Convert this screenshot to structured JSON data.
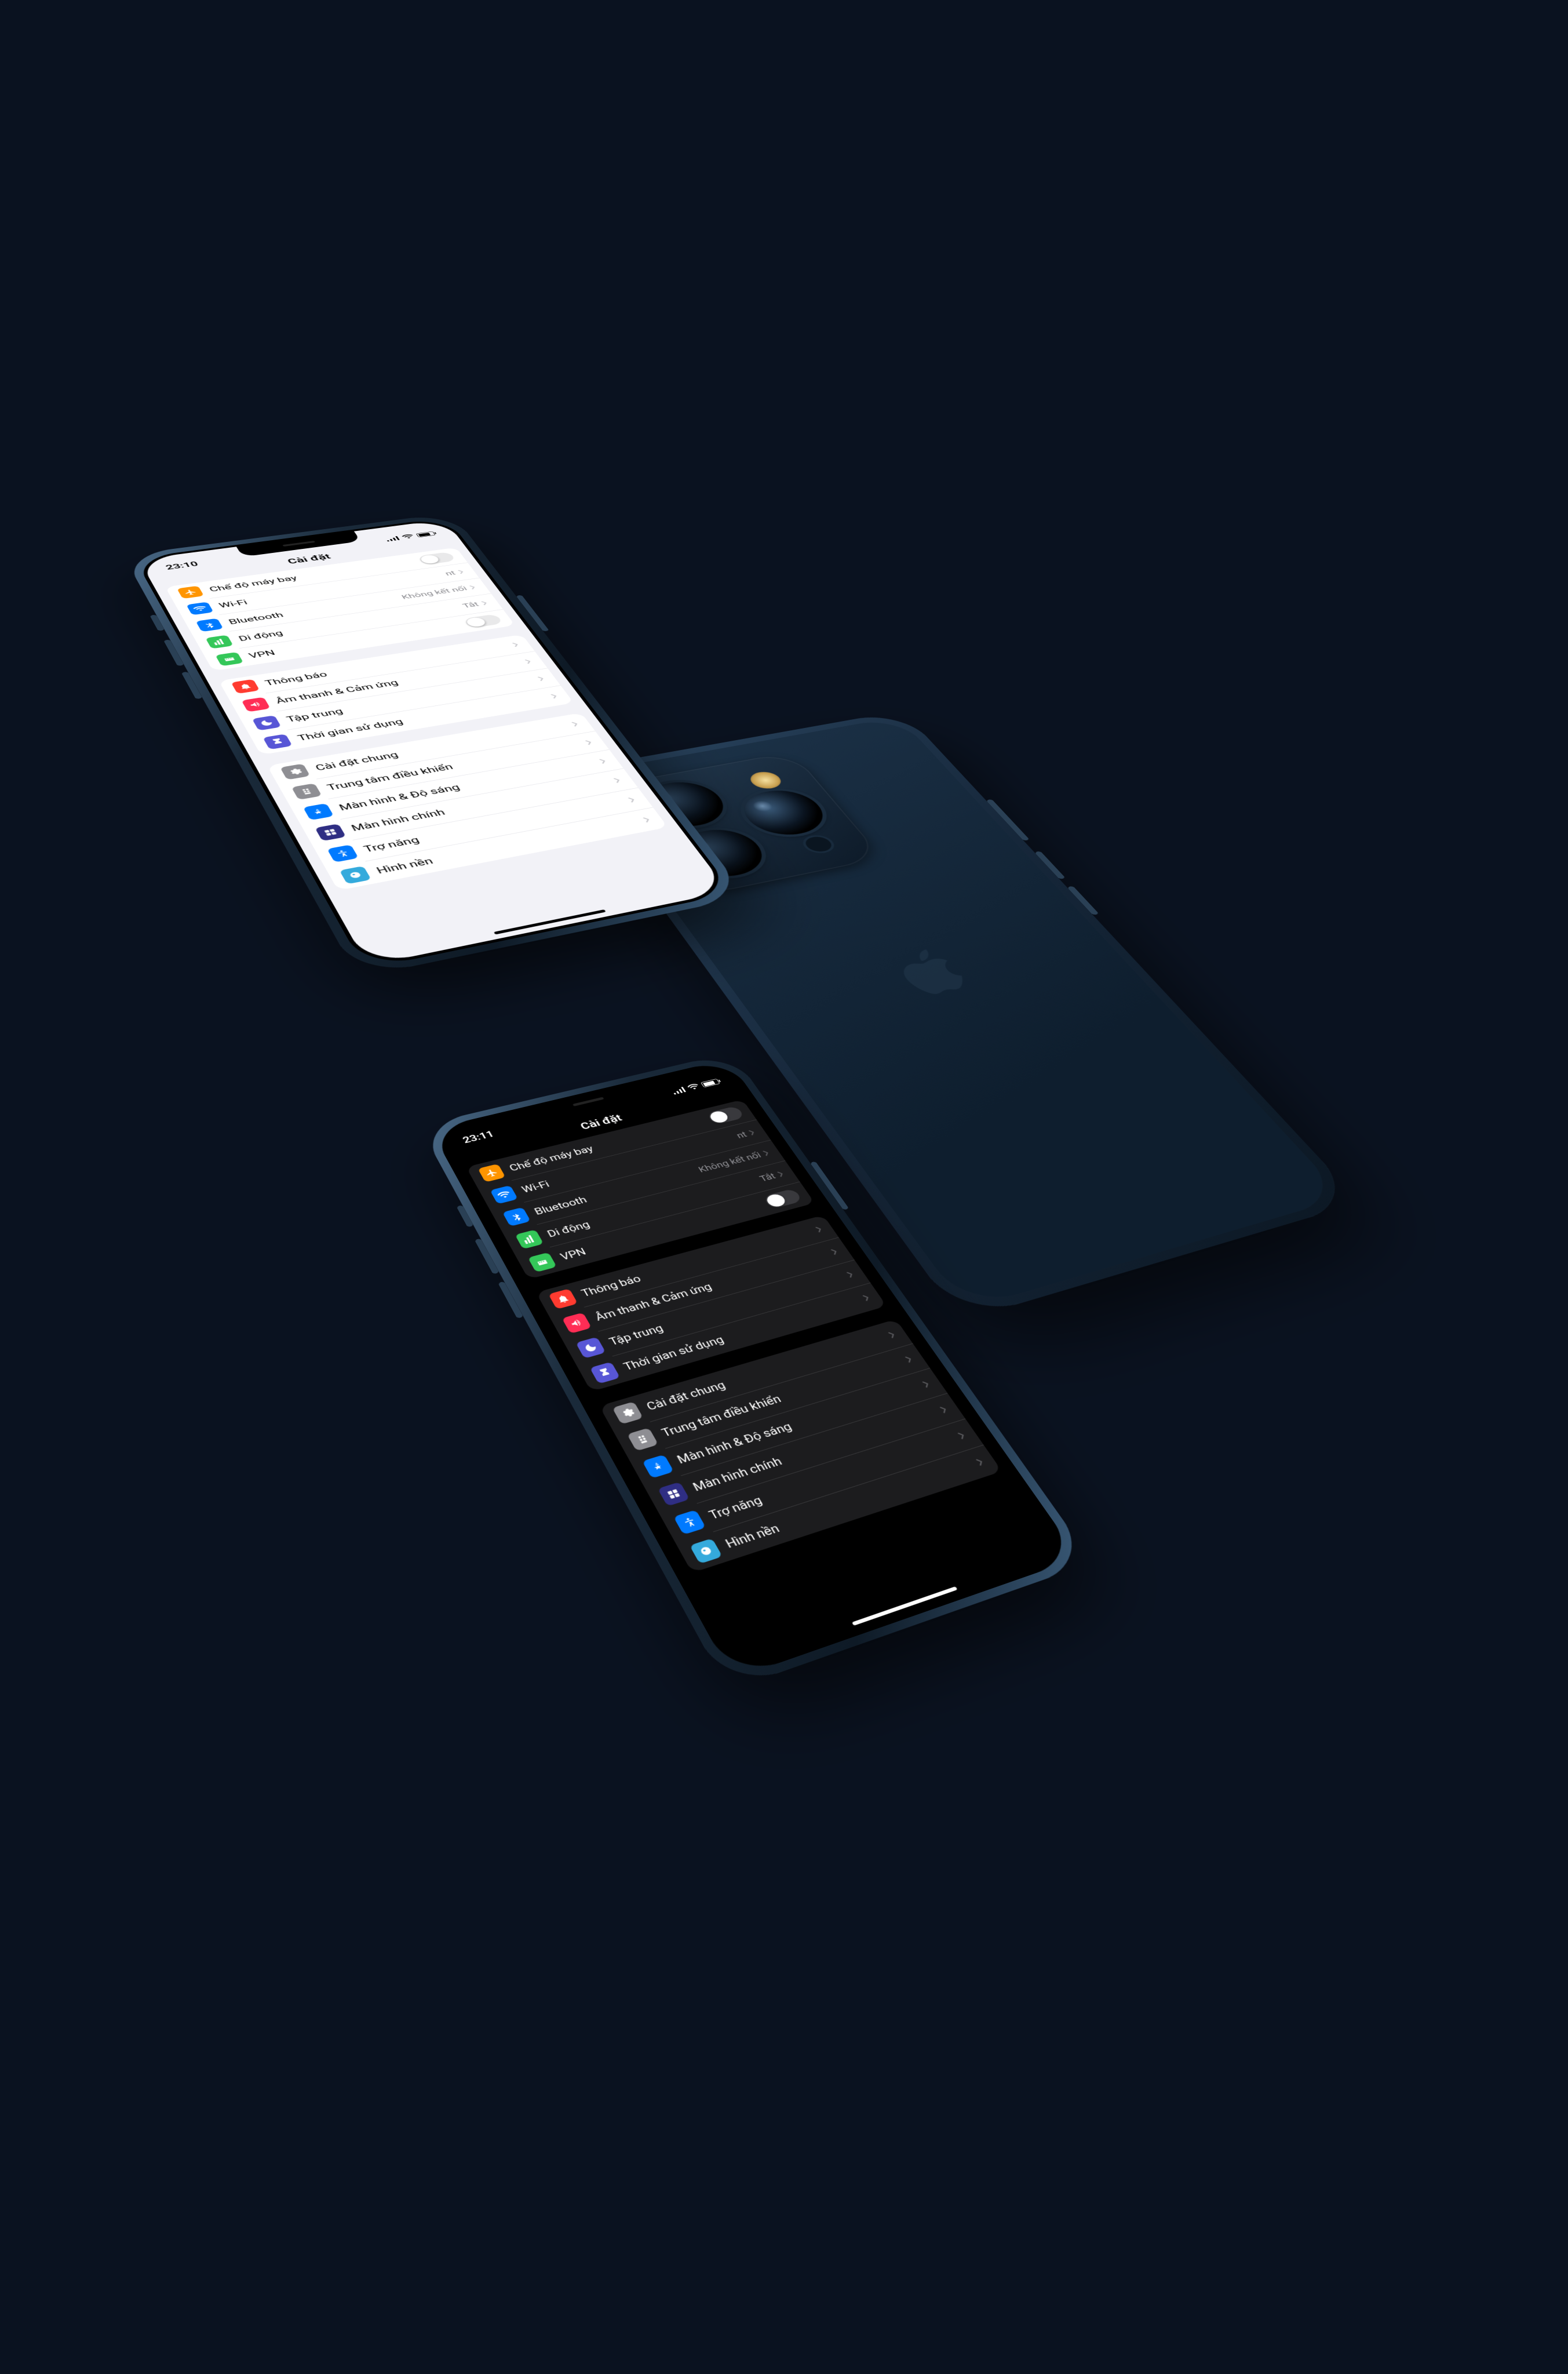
{
  "background_color": "#0a1220",
  "light": {
    "status": {
      "time": "23:10"
    },
    "title": "Cài đặt",
    "groups": [
      [
        {
          "icon": "airplane",
          "label": "Chế độ máy bay",
          "detail": "",
          "switch": true,
          "chevron": false
        },
        {
          "icon": "wifi",
          "label": "Wi-Fi",
          "detail": "nt",
          "switch": false,
          "chevron": true
        },
        {
          "icon": "bt",
          "label": "Bluetooth",
          "detail": "Không kết nối",
          "switch": false,
          "chevron": true
        },
        {
          "icon": "cell",
          "label": "Di động",
          "detail": "Tắt",
          "switch": false,
          "chevron": true
        },
        {
          "icon": "vpn",
          "label": "VPN",
          "detail": "",
          "switch": true,
          "chevron": false
        }
      ],
      [
        {
          "icon": "notif",
          "label": "Thông báo",
          "detail": "",
          "switch": false,
          "chevron": true
        },
        {
          "icon": "sound",
          "label": "Âm thanh & Cảm ứng",
          "detail": "",
          "switch": false,
          "chevron": true
        },
        {
          "icon": "focus",
          "label": "Tập trung",
          "detail": "",
          "switch": false,
          "chevron": true
        },
        {
          "icon": "screentime",
          "label": "Thời gian sử dụng",
          "detail": "",
          "switch": false,
          "chevron": true
        }
      ],
      [
        {
          "icon": "general",
          "label": "Cài đặt chung",
          "detail": "",
          "switch": false,
          "chevron": true
        },
        {
          "icon": "cc",
          "label": "Trung tâm điều khiển",
          "detail": "",
          "switch": false,
          "chevron": true
        },
        {
          "icon": "display",
          "label": "Màn hình & Độ sáng",
          "detail": "",
          "switch": false,
          "chevron": true
        },
        {
          "icon": "home",
          "label": "Màn hình chính",
          "detail": "",
          "switch": false,
          "chevron": true
        },
        {
          "icon": "access",
          "label": "Trợ năng",
          "detail": "",
          "switch": false,
          "chevron": true
        },
        {
          "icon": "wall",
          "label": "Hình nền",
          "detail": "",
          "switch": false,
          "chevron": true
        }
      ]
    ]
  },
  "dark": {
    "status": {
      "time": "23:11"
    },
    "title": "Cài đặt",
    "groups": [
      [
        {
          "icon": "airplane",
          "label": "Chế độ máy bay",
          "detail": "",
          "switch": true,
          "chevron": false
        },
        {
          "icon": "wifi",
          "label": "Wi-Fi",
          "detail": "nt",
          "switch": false,
          "chevron": true
        },
        {
          "icon": "bt",
          "label": "Bluetooth",
          "detail": "Không kết nối",
          "switch": false,
          "chevron": true
        },
        {
          "icon": "cell",
          "label": "Di động",
          "detail": "Tắt",
          "switch": false,
          "chevron": true
        },
        {
          "icon": "vpn",
          "label": "VPN",
          "detail": "",
          "switch": true,
          "chevron": false
        }
      ],
      [
        {
          "icon": "notif",
          "label": "Thông báo",
          "detail": "",
          "switch": false,
          "chevron": true
        },
        {
          "icon": "sound",
          "label": "Âm thanh & Cảm ứng",
          "detail": "",
          "switch": false,
          "chevron": true
        },
        {
          "icon": "focus",
          "label": "Tập trung",
          "detail": "",
          "switch": false,
          "chevron": true
        },
        {
          "icon": "screentime",
          "label": "Thời gian sử dụng",
          "detail": "",
          "switch": false,
          "chevron": true
        }
      ],
      [
        {
          "icon": "general",
          "label": "Cài đặt chung",
          "detail": "",
          "switch": false,
          "chevron": true
        },
        {
          "icon": "cc",
          "label": "Trung tâm điều khiển",
          "detail": "",
          "switch": false,
          "chevron": true
        },
        {
          "icon": "display",
          "label": "Màn hình & Độ sáng",
          "detail": "",
          "switch": false,
          "chevron": true
        },
        {
          "icon": "home",
          "label": "Màn hình chính",
          "detail": "",
          "switch": false,
          "chevron": true
        },
        {
          "icon": "access",
          "label": "Trợ năng",
          "detail": "",
          "switch": false,
          "chevron": true
        },
        {
          "icon": "wall",
          "label": "Hình nền",
          "detail": "",
          "switch": false,
          "chevron": true
        }
      ]
    ]
  },
  "icon_colors": {
    "airplane": "#ff9500",
    "wifi": "#007aff",
    "bt": "#007aff",
    "cell": "#34c759",
    "vpn": "#34c759",
    "notif": "#ff3b30",
    "sound": "#ff2d55",
    "focus": "#5856d6",
    "screentime": "#5856d6",
    "general": "#8e8e93",
    "cc": "#8e8e93",
    "display": "#007aff",
    "home": "#2f2e83",
    "access": "#007aff",
    "wall": "#34aadc"
  }
}
